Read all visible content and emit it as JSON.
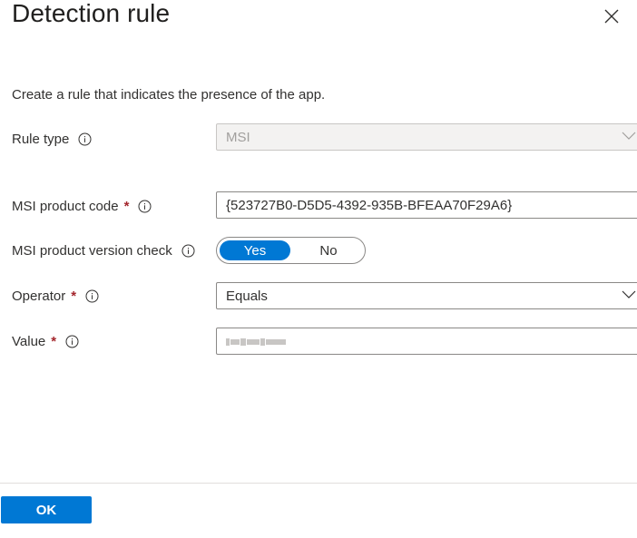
{
  "panel": {
    "title": "Detection rule",
    "description": "Create a rule that indicates the presence of the app."
  },
  "icons": {
    "close": "close-icon",
    "info": "info-icon",
    "chevron": "chevron-down-icon"
  },
  "fields": {
    "rule_type": {
      "label": "Rule type",
      "value": "MSI"
    },
    "product_code": {
      "label": "MSI product code",
      "required_mark": "*",
      "value": "{523727B0-D5D5-4392-935B-BFEAA70F29A6}"
    },
    "version_check": {
      "label": "MSI product version check",
      "on_label": "Yes",
      "off_label": "No"
    },
    "operator": {
      "label": "Operator",
      "required_mark": "*",
      "value": "Equals"
    },
    "value": {
      "label": "Value",
      "required_mark": "*"
    }
  },
  "footer": {
    "ok_label": "OK"
  },
  "colors": {
    "accent": "#0078d4",
    "required": "#a4262c",
    "border": "#8a8886"
  }
}
